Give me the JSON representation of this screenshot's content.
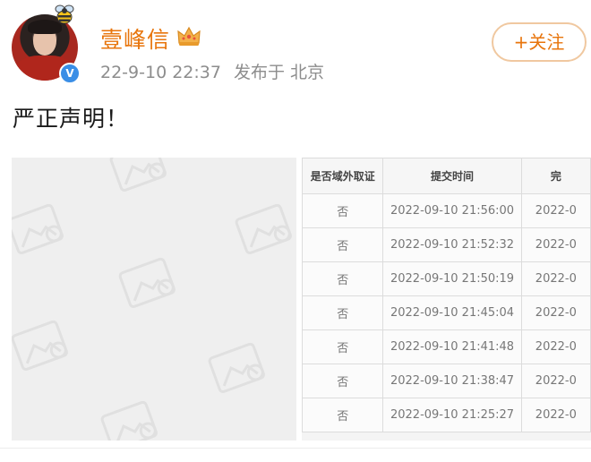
{
  "post": {
    "username": "壹峰信",
    "date": "22-9-10 22:37",
    "location": "发布于 北京",
    "follow_label": "+关注",
    "text": "严正声明！",
    "verified_symbol": "V"
  },
  "table": {
    "headers": [
      "是否域外取证",
      "提交时间",
      "完"
    ],
    "rows": [
      [
        "否",
        "2022-09-10 21:56:00",
        "2022-0"
      ],
      [
        "否",
        "2022-09-10 21:52:32",
        "2022-0"
      ],
      [
        "否",
        "2022-09-10 21:50:19",
        "2022-0"
      ],
      [
        "否",
        "2022-09-10 21:45:04",
        "2022-0"
      ],
      [
        "否",
        "2022-09-10 21:41:48",
        "2022-0"
      ],
      [
        "否",
        "2022-09-10 21:38:47",
        "2022-0"
      ],
      [
        "否",
        "2022-09-10 21:25:27",
        "2022-0"
      ]
    ]
  },
  "colors": {
    "accent": "#e8750c",
    "verified": "#3a8ee6",
    "meta_text": "#8d8d8d"
  },
  "icons": [
    "bee-icon",
    "crown-icon",
    "verified-icon",
    "image-placeholder-icon"
  ]
}
